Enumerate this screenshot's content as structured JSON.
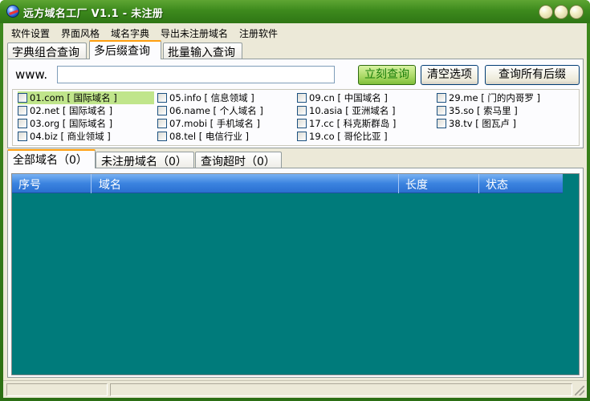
{
  "window": {
    "title": "远方域名工厂 V1.1 - 未注册",
    "title_color": "#ffffff",
    "frame_color": "#3d8a1d"
  },
  "menu": [
    "软件设置",
    "界面风格",
    "域名字典",
    "导出未注册域名",
    "注册软件"
  ],
  "top_tabs": [
    "字典组合查询",
    "多后缀查询",
    "批量输入查询"
  ],
  "active_top_tab": "多后缀查询",
  "query": {
    "prefix_label": "www.",
    "domain_value": "",
    "buttons": {
      "query": "立刻查询",
      "clear": "清空选项",
      "query_all": "查询所有后缀"
    }
  },
  "suffixes": [
    [
      "01.com [ 国际域名 ]",
      "02.net [ 国际域名 ]",
      "03.org [ 国际域名 ]",
      "04.biz [ 商业领域 ]"
    ],
    [
      "05.info [ 信息领域 ]",
      "06.name [ 个人域名 ]",
      "07.mobi [ 手机域名 ]",
      "08.tel [ 电信行业 ]"
    ],
    [
      "09.cn [ 中国域名 ]",
      "10.asia [ 亚洲域名 ]",
      "17.cc [ 科克斯群岛 ]",
      "19.co [ 哥伦比亚 ]"
    ],
    [
      "29.me [ 门的内哥罗 ]",
      "35.so [ 索马里 ]",
      "38.tv [ 图瓦卢 ]"
    ]
  ],
  "highlighted_suffix": "01.com [ 国际域名 ]",
  "highlight_color": "#c0e58b",
  "result_tabs": [
    "全部域名（0）",
    "未注册域名（0）",
    "查询超时（0）"
  ],
  "active_result_tab": "全部域名（0）",
  "table": {
    "columns": [
      "序号",
      "域名",
      "长度",
      "状态"
    ],
    "rows": [],
    "background_color": "#007b7b",
    "header_color": "#3c84e0"
  },
  "status": {
    "left": "",
    "right": ""
  }
}
